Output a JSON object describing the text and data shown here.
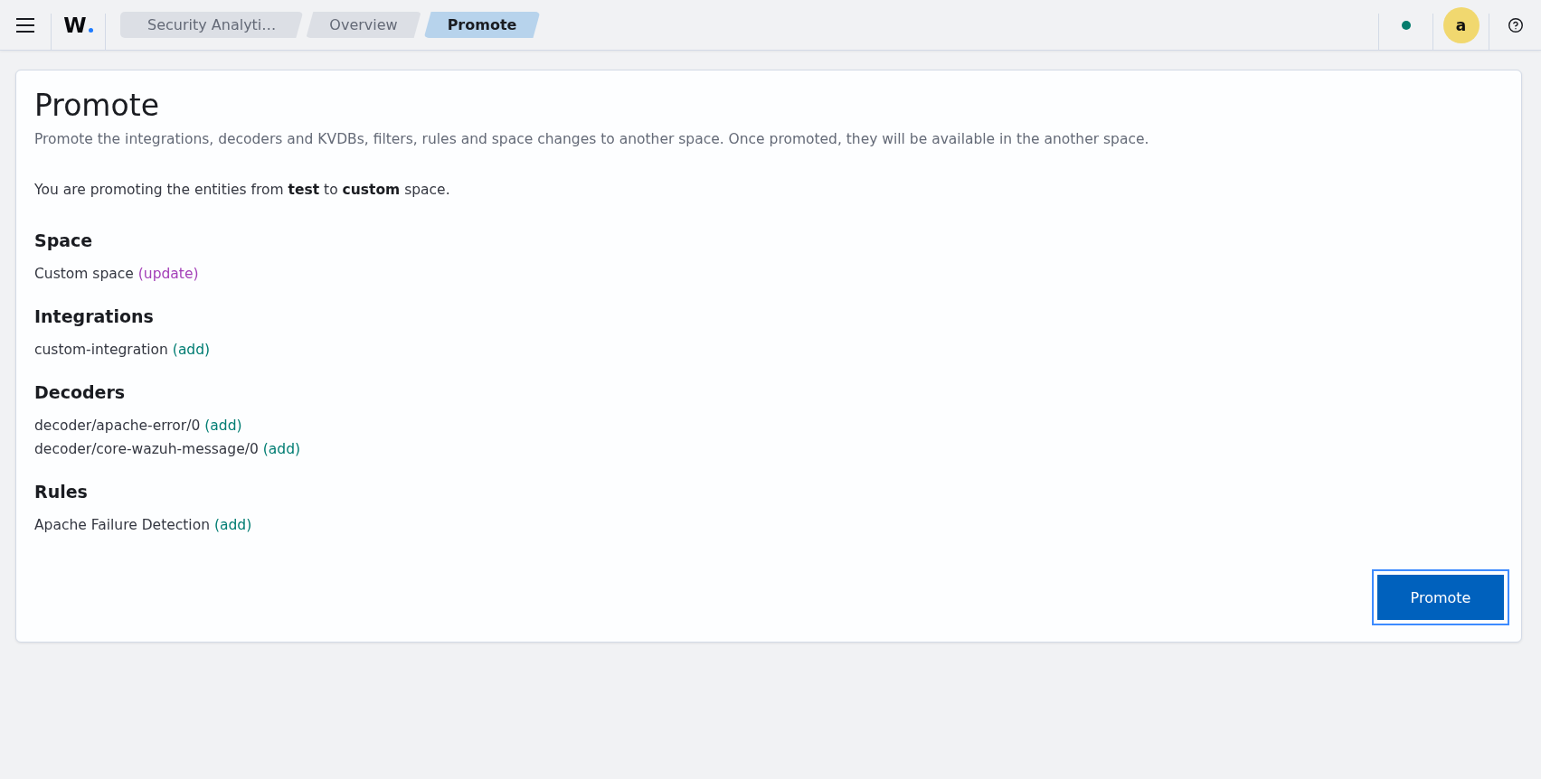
{
  "top_bar": {
    "logo": "W",
    "breadcrumbs": [
      {
        "label": "Security Analyti…",
        "selected": false
      },
      {
        "label": "Overview",
        "selected": false
      },
      {
        "label": "Promote",
        "selected": true
      }
    ],
    "avatar": "a"
  },
  "page": {
    "title": "Promote",
    "description": "Promote the integrations, decoders and KVDBs, filters, rules and space changes to another space. Once promoted, they will be available in the another space.",
    "summary": "You are promoting the entities from **test** to **custom** space.",
    "sections": [
      {
        "title": "Space",
        "items": [
          {
            "name": "Custom space",
            "change": "(update)",
            "kind": "update"
          }
        ]
      },
      {
        "title": "Integrations",
        "items": [
          {
            "name": "custom-integration",
            "change": "(add)",
            "kind": "add"
          }
        ]
      },
      {
        "title": "Decoders",
        "items": [
          {
            "name": "decoder/apache-error/0",
            "change": "(add)",
            "kind": "add"
          },
          {
            "name": "decoder/core-wazuh-message/0",
            "change": "(add)",
            "kind": "add"
          }
        ]
      },
      {
        "title": "Rules",
        "items": [
          {
            "name": "Apache Failure Detection",
            "change": "(add)",
            "kind": "add"
          }
        ]
      }
    ]
  },
  "actions": {
    "promote": {
      "label": "Promote",
      "focused": true
    }
  }
}
